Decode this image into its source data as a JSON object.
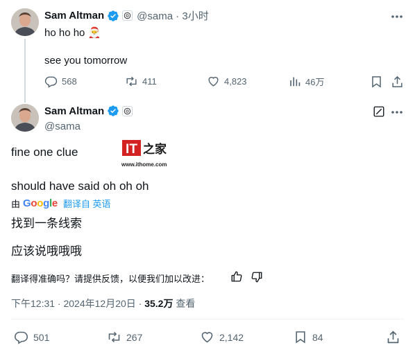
{
  "tweet1": {
    "author_name": "Sam Altman",
    "handle_time": "@sama · 3小时",
    "line1": "ho ho ho",
    "line1_emoji": "🎅",
    "line2": "see you tomorrow",
    "stats": {
      "replies": "568",
      "reposts": "411",
      "likes": "4,823",
      "views": "46万"
    }
  },
  "tweet2": {
    "author_name": "Sam Altman",
    "handle": "@sama",
    "text_line1": "fine one clue",
    "text_line2": "should have said oh oh oh",
    "translate": {
      "prefix": "由",
      "google_letters": [
        "G",
        "o",
        "o",
        "g",
        "l",
        "e"
      ],
      "google_colors": [
        "#4285F4",
        "#EA4335",
        "#FBBC05",
        "#4285F4",
        "#34A853",
        "#EA4335"
      ],
      "link": "翻译自 英语",
      "translated_line1": "找到一条线索",
      "translated_line2": "应该说哦哦哦",
      "feedback_question": "翻译得准确吗？请提供反馈，以便我们加以改进："
    },
    "timestamp": "下午12:31 · 2024年12月20日 · ",
    "views_count": "35.2万",
    "views_label": " 查看",
    "stats": {
      "replies": "501",
      "reposts": "267",
      "likes": "2,142",
      "bookmarks": "84"
    }
  },
  "watermark": {
    "brand": "IT之家",
    "url": "www.ithome.com"
  },
  "colors": {
    "accent": "#1d9bf0",
    "verified": "#1d9bf0",
    "ithome_red": "#d22222",
    "muted": "#536471"
  }
}
